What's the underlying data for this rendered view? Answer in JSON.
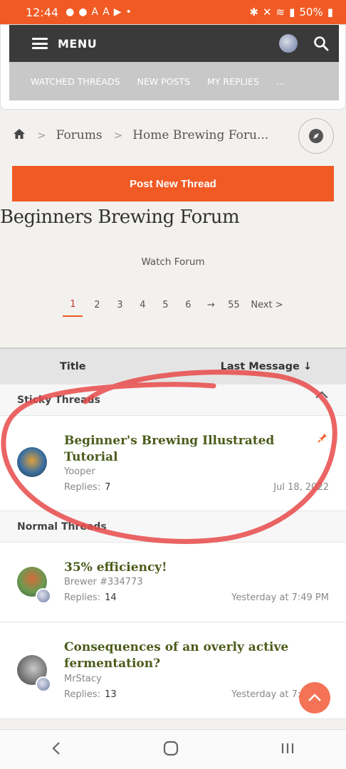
{
  "status_bar": {
    "time": "12:44",
    "battery": "50%"
  },
  "menu": {
    "label": "MENU"
  },
  "submenu": {
    "items": [
      "WATCHED THREADS",
      "NEW POSTS",
      "MY REPLIES",
      "..."
    ]
  },
  "breadcrumb": {
    "items": [
      "Forums",
      "Home Brewing Foru..."
    ]
  },
  "post_button": "Post New Thread",
  "page_title": "Beginners Brewing Forum",
  "watch_forum": "Watch Forum",
  "pagination": {
    "pages": [
      "1",
      "2",
      "3",
      "4",
      "5",
      "6",
      "→",
      "55"
    ],
    "current": "1",
    "next": "Next >"
  },
  "list_header": {
    "title": "Title",
    "last_message": "Last Message ↓"
  },
  "sections": {
    "sticky": "Sticky Threads",
    "normal": "Normal Threads"
  },
  "threads": [
    {
      "title": "Beginner's Brewing Illustrated Tutorial",
      "author": "Yooper",
      "replies_label": "Replies:",
      "replies": "7",
      "date": "Jul 18, 2022"
    },
    {
      "title": "35% efficiency!",
      "author": "Brewer #334773",
      "replies_label": "Replies:",
      "replies": "14",
      "date": "Yesterday at 7:49 PM"
    },
    {
      "title": "Consequences of an overly active fermentation?",
      "author": "MrStacy",
      "replies_label": "Replies:",
      "replies": "13",
      "date": "Yesterday at 7:48 PM"
    }
  ],
  "colors": {
    "accent": "#f15a24",
    "thread_title": "#4b5c1b",
    "menubar": "#3a3a3a",
    "annotation": "#e84a4a"
  }
}
